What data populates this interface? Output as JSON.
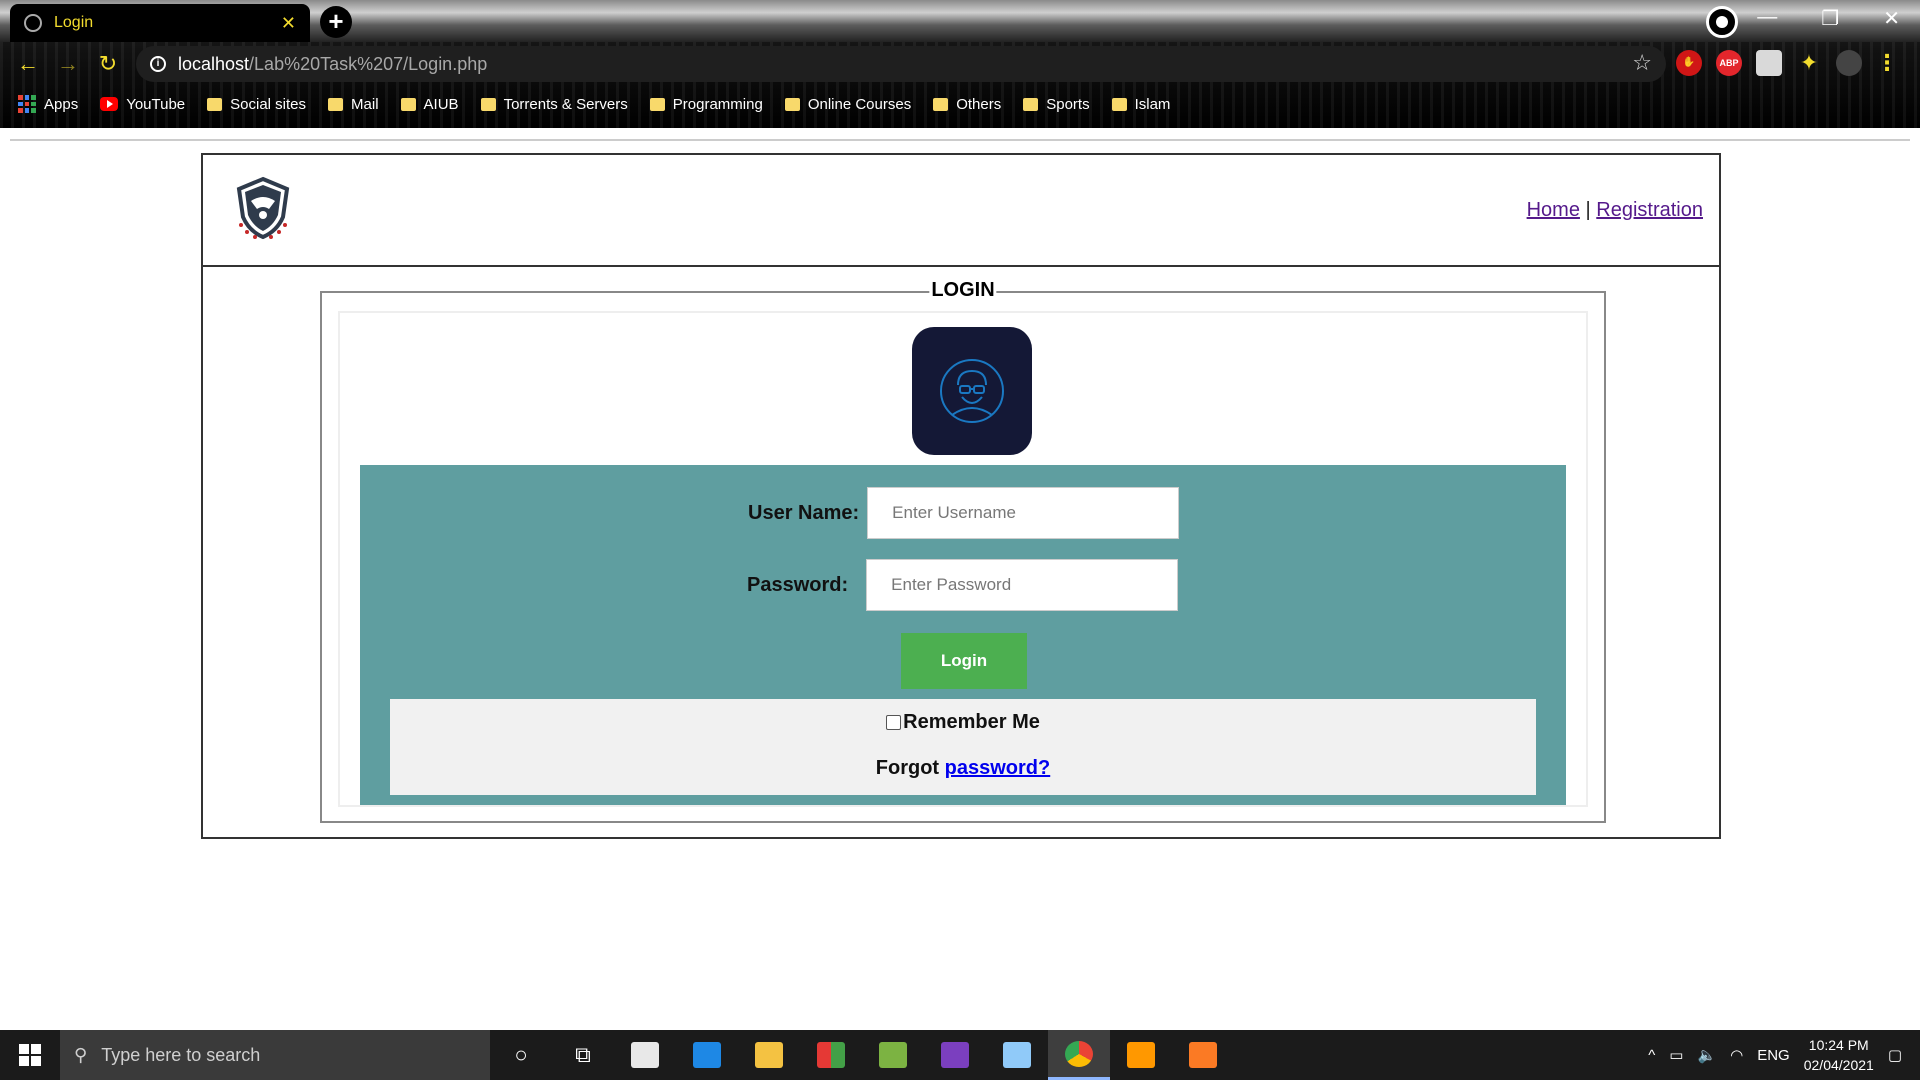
{
  "browser": {
    "tab_title": "Login",
    "url_host": "localhost",
    "url_path": "/Lab%20Task%207/Login.php",
    "extensions": [
      "adblock-icon",
      "abp-icon",
      "extension-icon",
      "puzzle-icon",
      "profile-avatar"
    ],
    "bookmarks": [
      {
        "label": "Apps",
        "icon": "apps-icon"
      },
      {
        "label": "YouTube",
        "icon": "youtube-icon"
      },
      {
        "label": "Social sites",
        "icon": "folder-icon"
      },
      {
        "label": "Mail",
        "icon": "folder-icon"
      },
      {
        "label": "AIUB",
        "icon": "folder-icon"
      },
      {
        "label": "Torrents & Servers",
        "icon": "folder-icon"
      },
      {
        "label": "Programming",
        "icon": "folder-icon"
      },
      {
        "label": "Online Courses",
        "icon": "folder-icon"
      },
      {
        "label": "Others",
        "icon": "folder-icon"
      },
      {
        "label": "Sports",
        "icon": "folder-icon"
      },
      {
        "label": "Islam",
        "icon": "folder-icon"
      }
    ]
  },
  "header": {
    "nav_home": "Home",
    "nav_separator": "|",
    "nav_registration": "Registration"
  },
  "login": {
    "legend": "LOGIN",
    "username_label": "User Name:",
    "username_placeholder": "Enter Username",
    "password_label": "Password:",
    "password_placeholder": "Enter Password",
    "submit_label": "Login",
    "remember_label": "Remember Me",
    "forgot_prefix": "Forgot",
    "forgot_link": "password?"
  },
  "colors": {
    "panel": "#5f9ea0",
    "button": "#4caf50",
    "avatar_bg": "#141836",
    "link": "#0000ee",
    "visited_link": "#551a8b"
  },
  "taskbar": {
    "search_placeholder": "Type here to search",
    "language": "ENG",
    "time": "10:24 PM",
    "date": "02/04/2021"
  }
}
